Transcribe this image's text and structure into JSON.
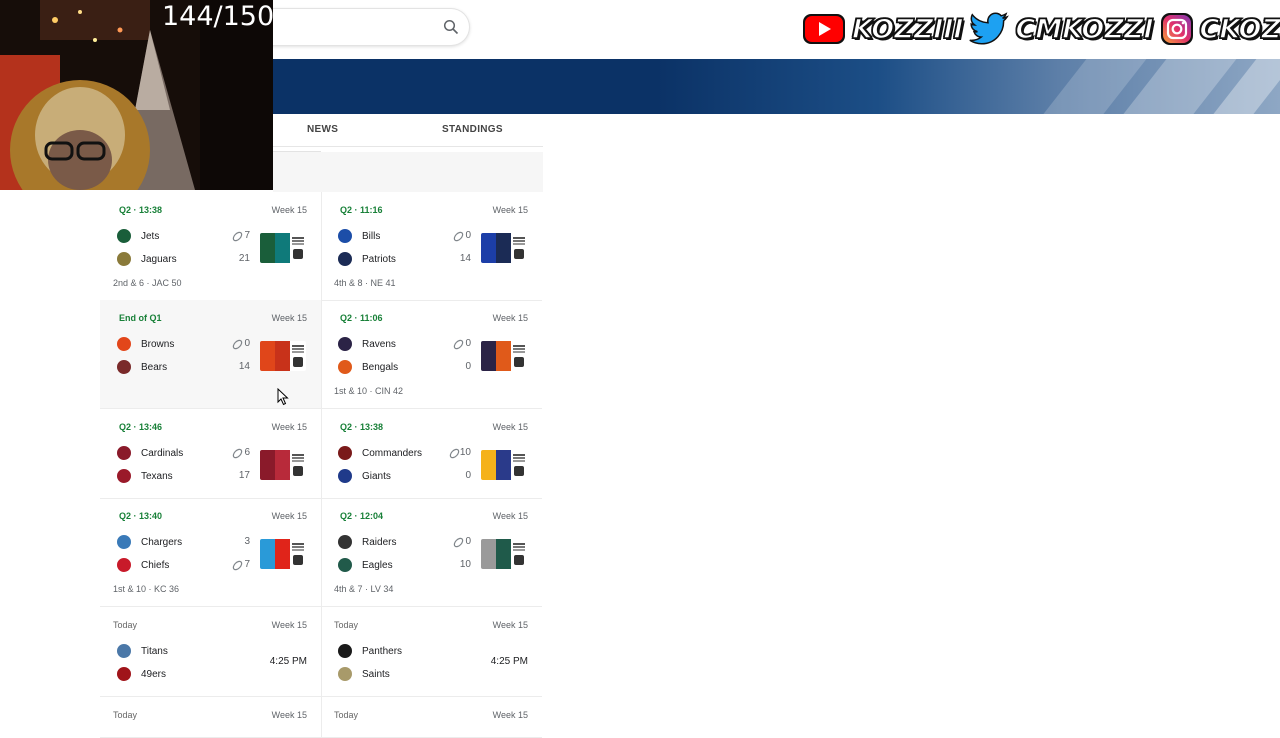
{
  "webcam": {
    "counter": "144/150"
  },
  "social": {
    "youtube": "KOZZIII",
    "twitter": "CMKOZZI",
    "instagram": "CKOZZI"
  },
  "tabs": {
    "news": "NEWS",
    "standings": "STANDINGS"
  },
  "games": [
    {
      "status": "Q2 · 13:38",
      "week": "Week 15",
      "away": "Jets",
      "away_score": "7",
      "home": "Jaguars",
      "home_score": "21",
      "possession": "away",
      "detail": "2nd & 6 · JAC 50"
    },
    {
      "status": "Q2 · 11:16",
      "week": "Week 15",
      "away": "Bills",
      "away_score": "0",
      "home": "Patriots",
      "home_score": "14",
      "possession": "away",
      "detail": "4th & 8 · NE 41"
    },
    {
      "status": "End of Q1",
      "week": "Week 15",
      "away": "Browns",
      "away_score": "0",
      "home": "Bears",
      "home_score": "14",
      "possession": "away",
      "detail": ""
    },
    {
      "status": "Q2 · 11:06",
      "week": "Week 15",
      "away": "Ravens",
      "away_score": "0",
      "home": "Bengals",
      "home_score": "0",
      "possession": "away",
      "detail": "1st & 10 · CIN 42"
    },
    {
      "status": "Q2 · 13:46",
      "week": "Week 15",
      "away": "Cardinals",
      "away_score": "6",
      "home": "Texans",
      "home_score": "17",
      "possession": "away",
      "detail": ""
    },
    {
      "status": "Q2 · 13:38",
      "week": "Week 15",
      "away": "Commanders",
      "away_score": "10",
      "home": "Giants",
      "home_score": "0",
      "possession": "away",
      "detail": ""
    },
    {
      "status": "Q2 · 13:40",
      "week": "Week 15",
      "away": "Chargers",
      "away_score": "3",
      "home": "Chiefs",
      "home_score": "7",
      "possession": "home",
      "detail": "1st & 10 · KC 36"
    },
    {
      "status": "Q2 · 12:04",
      "week": "Week 15",
      "away": "Raiders",
      "away_score": "0",
      "home": "Eagles",
      "home_score": "10",
      "possession": "away",
      "detail": "4th & 7 · LV 34"
    },
    {
      "status": "Today",
      "week": "Week 15",
      "away": "Titans",
      "away_score": "",
      "home": "49ers",
      "home_score": "",
      "time": "4:25 PM"
    },
    {
      "status": "Today",
      "week": "Week 15",
      "away": "Panthers",
      "away_score": "",
      "home": "Saints",
      "home_score": "",
      "time": "4:25 PM"
    },
    {
      "status": "Today",
      "week": "Week 15"
    },
    {
      "status": "Today",
      "week": "Week 15"
    }
  ],
  "colors": {
    "banner": "#0b3266",
    "live_status": "#188038",
    "youtube": "#ff0000",
    "twitter": "#1da1f2",
    "instagram": "#c13584"
  }
}
